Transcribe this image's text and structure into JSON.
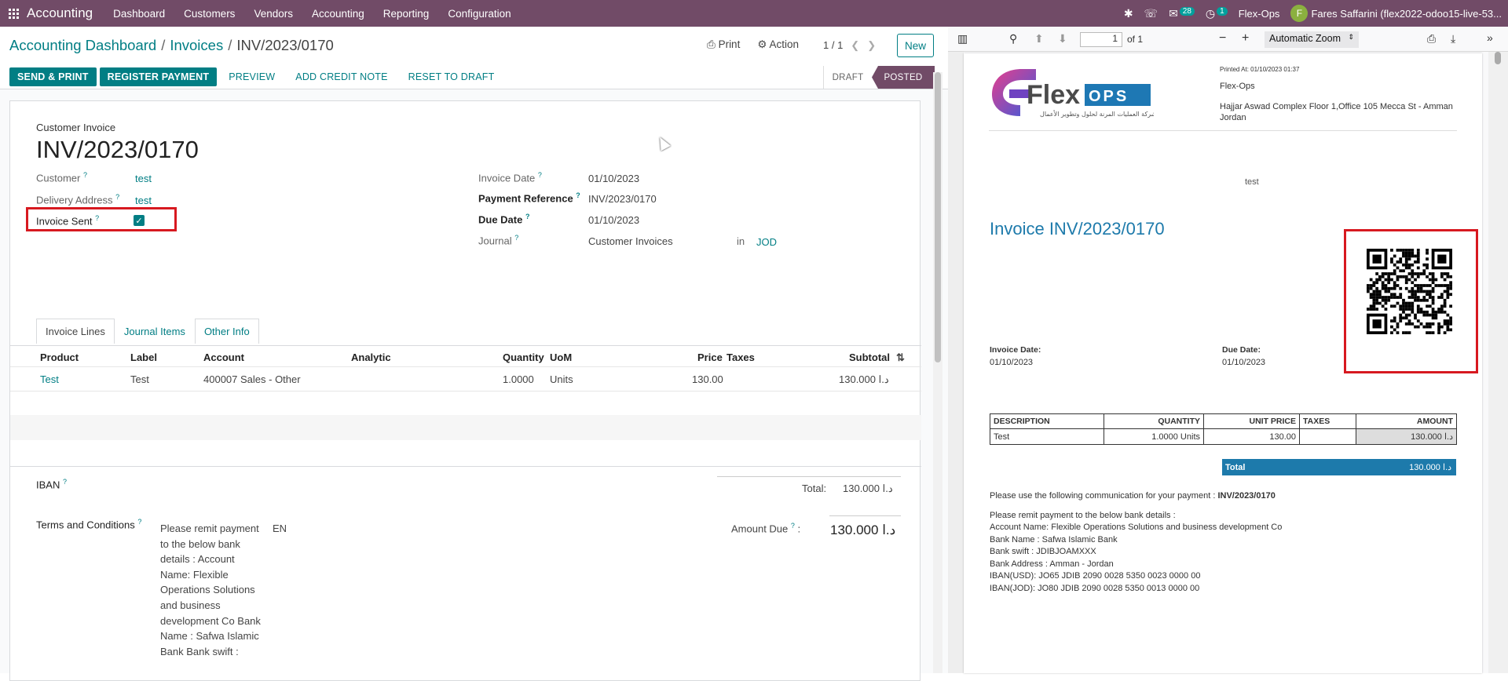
{
  "topnav": {
    "app_name": "Accounting",
    "menu": [
      "Dashboard",
      "Customers",
      "Vendors",
      "Accounting",
      "Reporting",
      "Configuration"
    ],
    "messages_count": "28",
    "activities_count": "1",
    "company": "Flex-Ops",
    "avatar_letter": "F",
    "user": "Fares Saffarini (flex2022-odoo15-live-53..."
  },
  "control_panel": {
    "breadcrumb": [
      "Accounting Dashboard",
      "Invoices",
      "INV/2023/0170"
    ],
    "print_label": "Print",
    "action_label": "Action",
    "pager": "1 / 1",
    "new_label": "New"
  },
  "buttons": {
    "send_print": "SEND & PRINT",
    "register_payment": "REGISTER PAYMENT",
    "preview": "PREVIEW",
    "add_credit_note": "ADD CREDIT NOTE",
    "reset_to_draft": "RESET TO DRAFT"
  },
  "status": {
    "draft": "DRAFT",
    "posted": "POSTED"
  },
  "invoice": {
    "type": "Customer Invoice",
    "name": "INV/2023/0170",
    "customer_label": "Customer",
    "customer": "test",
    "delivery_label": "Delivery Address",
    "delivery": "test",
    "sent_label": "Invoice Sent",
    "invoice_date_label": "Invoice Date",
    "invoice_date": "01/10/2023",
    "payment_ref_label": "Payment Reference",
    "payment_ref": "INV/2023/0170",
    "due_date_label": "Due Date",
    "due_date": "01/10/2023",
    "journal_label": "Journal",
    "journal": "Customer Invoices",
    "journal_in": "in",
    "currency": "JOD"
  },
  "tabs": [
    "Invoice Lines",
    "Journal Items",
    "Other Info"
  ],
  "lines": {
    "headers": [
      "Product",
      "Label",
      "Account",
      "Analytic",
      "Quantity",
      "UoM",
      "Price",
      "Taxes",
      "Subtotal"
    ],
    "rows": [
      {
        "product": "Test",
        "label": "Test",
        "account": "400007 Sales - Other",
        "analytic": "",
        "quantity": "1.0000",
        "uom": "Units",
        "price": "130.00",
        "taxes": "",
        "subtotal": "130.000 د.ا"
      }
    ]
  },
  "footer": {
    "iban_label": "IBAN",
    "terms_label": "Terms and Conditions",
    "terms_text": "Please remit payment to the below bank details : Account Name: Flexible Operations Solutions and business development Co Bank Name : Safwa Islamic Bank Bank swift :",
    "lang": "EN",
    "total_label": "Total:",
    "total": "130.000 د.ا",
    "amount_due_label": "Amount Due",
    "amount_due": "130.000 د.ا"
  },
  "pdf": {
    "page": "1",
    "of": "of 1",
    "zoom": "Automatic Zoom",
    "printed_at": "Printed At:   01/10/2023 01:37",
    "company": "Flex-Ops",
    "address1": "Hajjar Aswad Complex Floor 1,Office 105 Mecca St - Amman",
    "address2": "Jordan",
    "logo_text": "Flex",
    "logo_ops": "OPS",
    "logo_arabic": "شركة العمليات المرنة لحلول وتطوير الأعمال",
    "partner": "test",
    "title": "Invoice INV/2023/0170",
    "invoice_date_label": "Invoice Date:",
    "invoice_date": "01/10/2023",
    "due_date_label": "Due Date:",
    "due_date": "01/10/2023",
    "table_headers": [
      "DESCRIPTION",
      "QUANTITY",
      "UNIT PRICE",
      "TAXES",
      "AMOUNT"
    ],
    "table_row": [
      "Test",
      "1.0000 Units",
      "130.00",
      "",
      "130.000 د.ا"
    ],
    "total_label": "Total",
    "total": "130.000 د.ا",
    "comm_prefix": "Please use the following communication for your payment : ",
    "comm_ref": "INV/2023/0170",
    "bank_lines": [
      "Please remit payment to the below bank details :",
      "Account Name: Flexible Operations Solutions and business development Co",
      "Bank Name : Safwa Islamic Bank",
      "Bank swift : JDIBJOAMXXX",
      "Bank Address : Amman - Jordan",
      "IBAN(USD): JO65 JDIB 2090 0028 5350 0023 0000 00",
      "IBAN(JOD): JO80 JDIB 2090 0028 5350 0013 0000 00"
    ]
  },
  "colors": {
    "brand": "#714b67",
    "accent": "#017e84",
    "highlight": "#d71920",
    "pdf_blue": "#1d7aab"
  }
}
